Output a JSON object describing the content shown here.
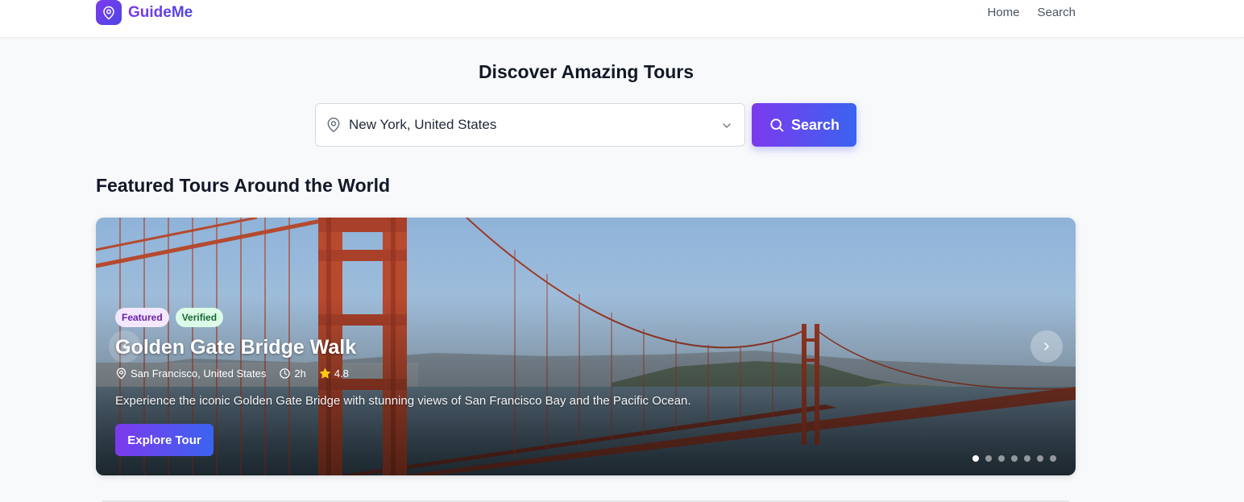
{
  "header": {
    "brand": "GuideMe",
    "nav": [
      "Home",
      "Search"
    ]
  },
  "hero": {
    "title": "Discover Amazing Tours",
    "location_value": "New York, United States",
    "search_label": "Search"
  },
  "featured": {
    "section_title": "Featured Tours Around the World",
    "slide": {
      "badges": [
        "Featured",
        "Verified"
      ],
      "title": "Golden Gate Bridge Walk",
      "location": "San Francisco, United States",
      "duration": "2h",
      "rating": "4.8",
      "description": "Experience the iconic Golden Gate Bridge with stunning views of San Francisco Bay and the Pacific Ocean.",
      "cta": "Explore Tour"
    },
    "slide_count": 7,
    "active_slide": 1
  },
  "colors": {
    "accent_start": "#7c3aed",
    "accent_end": "#3b63f0",
    "featured_badge_bg": "#f3e8ff",
    "verified_badge_bg": "#dcfce7",
    "star": "#facc15"
  },
  "icons": {
    "logo": "map-pin-icon",
    "location_select": "map-pin-icon",
    "dropdown": "chevron-down-icon",
    "search": "search-icon",
    "meta_location": "map-pin-icon",
    "meta_duration": "clock-icon",
    "meta_rating": "star-icon",
    "carousel_prev": "chevron-left-icon",
    "carousel_next": "chevron-right-icon"
  }
}
